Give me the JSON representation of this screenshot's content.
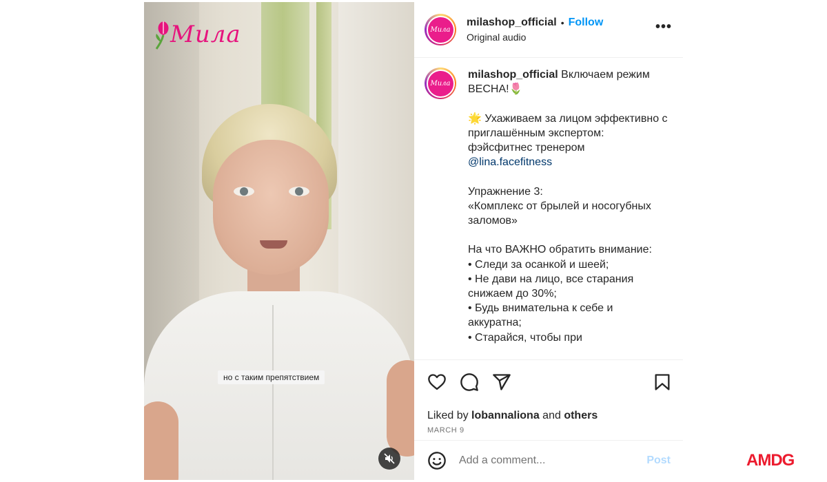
{
  "video": {
    "brand_wordmark": "Мила",
    "subtitle": "но с таким препятствием",
    "mute_icon": "speaker-muted-icon"
  },
  "post_header": {
    "username": "milashop_official",
    "separator": "•",
    "follow_label": "Follow",
    "audio_label": "Original audio",
    "avatar_text": "Мила",
    "more_icon": "more-horizontal-icon",
    "more_label": "•••"
  },
  "caption": {
    "username": "milashop_official",
    "part1": " Включаем режим ВЕСНА!🌷\n\n🌟 Ухаживаем за лицом эффективно с приглашённым экспертом: фэйсфитнес тренером ",
    "mention": "@lina.facefitness",
    "part2": "\n\nУпражнение 3:\n«Комплекс от брылей и носогубных заломов»\n\nНа что ВАЖНО обратить внимание:\n• Следи за осанкой и шеей;\n• Не дави на лицо, все старания снижаем до 30%;\n• Будь внимательна к себе и аккуратна;\n• Старайся, чтобы при"
  },
  "actions": {
    "icons": [
      "heart-icon",
      "comment-icon",
      "share-icon",
      "bookmark-icon"
    ],
    "liked_by_prefix": "Liked by ",
    "liked_by_user": "lobannaliona",
    "liked_by_and": " and ",
    "liked_by_others": "others",
    "date": "MARCH 9"
  },
  "comment": {
    "placeholder": "Add a comment...",
    "post_label": "Post",
    "emoji_icon": "emoji-smile-icon"
  },
  "watermark": {
    "text": "AMDG"
  },
  "colors": {
    "brand_pink": "#ea1d8b",
    "follow_blue": "#0095f6",
    "post_disabled": "#b3dbff",
    "watermark_red": "#ec1b2e"
  }
}
